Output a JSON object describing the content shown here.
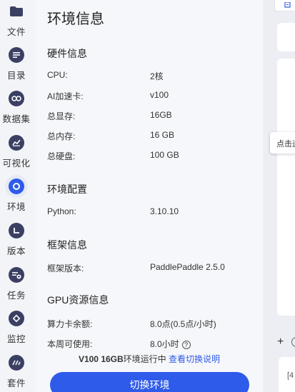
{
  "sidebar": {
    "items": [
      {
        "label": "文件",
        "icon": "folder-icon"
      },
      {
        "label": "目录",
        "icon": "list-icon"
      },
      {
        "label": "数据集",
        "icon": "dataset-icon"
      },
      {
        "label": "可视化",
        "icon": "chart-icon"
      },
      {
        "label": "环境",
        "icon": "environment-icon"
      },
      {
        "label": "版本",
        "icon": "version-icon"
      },
      {
        "label": "任务",
        "icon": "task-icon"
      },
      {
        "label": "监控",
        "icon": "monitor-icon"
      },
      {
        "label": "套件",
        "icon": "suite-icon"
      }
    ],
    "active": "环境",
    "accent": "#2f5bea"
  },
  "panel": {
    "title": "环境信息",
    "hardware": {
      "title": "硬件信息",
      "rows": [
        {
          "label": "CPU:",
          "value": "2核"
        },
        {
          "label": "AI加速卡:",
          "value": "v100"
        },
        {
          "label": "总显存:",
          "value": "16GB"
        },
        {
          "label": "总内存:",
          "value": "16 GB"
        },
        {
          "label": "总硬盘:",
          "value": "100 GB"
        }
      ]
    },
    "env_config": {
      "title": "环境配置",
      "rows": [
        {
          "label": "Python:",
          "value": "3.10.10"
        }
      ]
    },
    "framework": {
      "title": "框架信息",
      "rows": [
        {
          "label": "框架版本:",
          "value": "PaddlePaddle 2.5.0"
        }
      ]
    },
    "gpu": {
      "title": "GPU资源信息",
      "rows": [
        {
          "label": "算力卡余额:",
          "value": "8.0点(0.5点/小时)"
        },
        {
          "label": "本周可使用:",
          "value": "8.0小时"
        }
      ]
    },
    "footnote": {
      "env_text": "V100 16GB",
      "running_text": "环境运行中",
      "link_text": "查看切换说明"
    },
    "switch_button": "切换环境"
  },
  "right": {
    "tooltip": "点击运",
    "code_snippet": "[4"
  }
}
